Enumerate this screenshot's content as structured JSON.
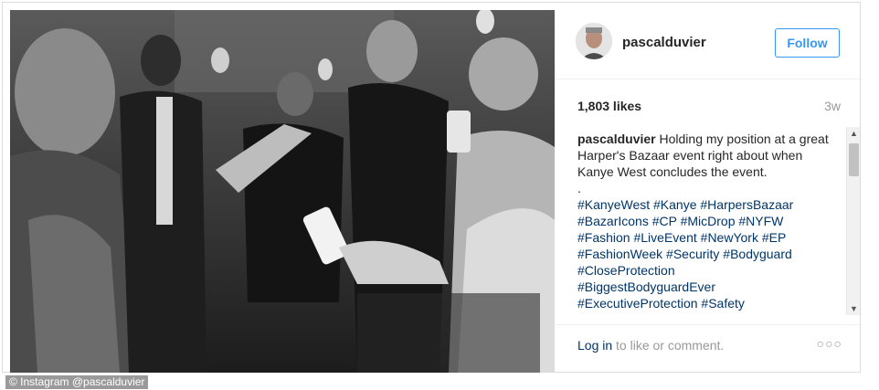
{
  "post": {
    "username": "pascalduvier",
    "follow_label": "Follow",
    "likes": "1,803 likes",
    "time_ago": "3w",
    "caption_user": "pascalduvier",
    "caption_text": " Holding my position at a great Harper's Bazaar event right about when Kanye West concludes the event.",
    "caption_dot": ".",
    "hashtags": [
      "#KanyeWest",
      "#Kanye",
      "#HarpersBazaar",
      "#BazarIcons",
      "#CP",
      "#MicDrop",
      "#NYFW",
      "#Fashion",
      "#LiveEvent",
      "#NewYork",
      "#EP",
      "#FashionWeek",
      "#Security",
      "#Bodyguard",
      "#CloseProtection",
      "#BiggestBodyguardEver",
      "#ExecutiveProtection",
      "#Safety"
    ],
    "login_link": "Log in",
    "login_rest": " to like or comment.",
    "more_glyph": "○○○"
  },
  "credit": "© Instagram @pascalduvier",
  "icons": {
    "scroll_up": "▲",
    "scroll_down": "▼"
  }
}
